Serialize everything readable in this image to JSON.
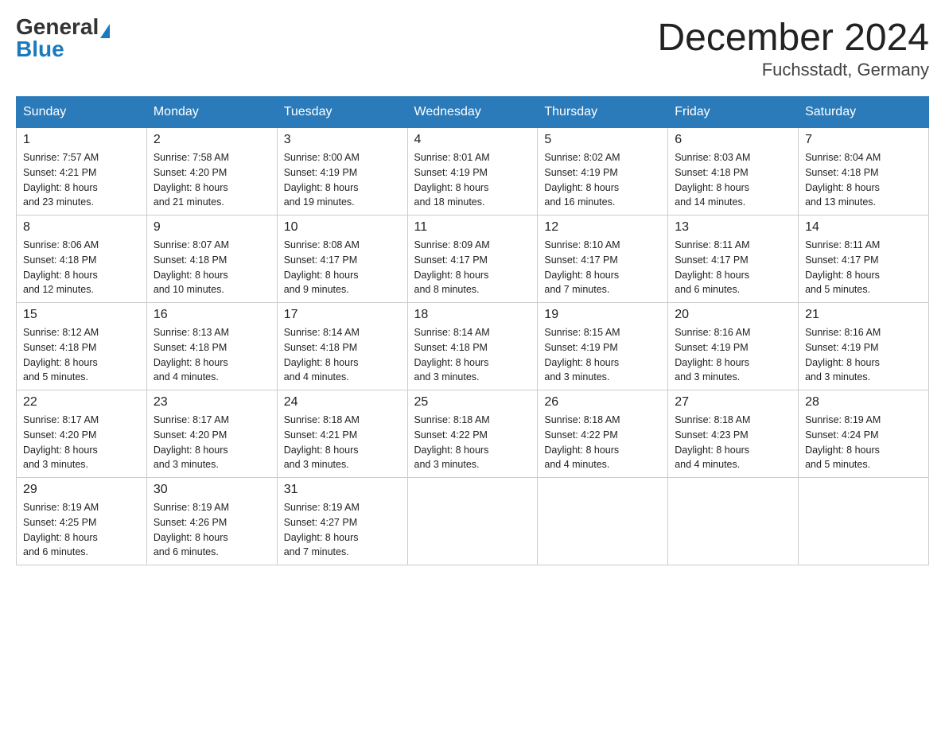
{
  "header": {
    "logo_general": "General",
    "logo_blue": "Blue",
    "month_title": "December 2024",
    "location": "Fuchsstadt, Germany"
  },
  "weekdays": [
    "Sunday",
    "Monday",
    "Tuesday",
    "Wednesday",
    "Thursday",
    "Friday",
    "Saturday"
  ],
  "weeks": [
    [
      {
        "day": "1",
        "sunrise": "7:57 AM",
        "sunset": "4:21 PM",
        "daylight": "8 hours and 23 minutes."
      },
      {
        "day": "2",
        "sunrise": "7:58 AM",
        "sunset": "4:20 PM",
        "daylight": "8 hours and 21 minutes."
      },
      {
        "day": "3",
        "sunrise": "8:00 AM",
        "sunset": "4:19 PM",
        "daylight": "8 hours and 19 minutes."
      },
      {
        "day": "4",
        "sunrise": "8:01 AM",
        "sunset": "4:19 PM",
        "daylight": "8 hours and 18 minutes."
      },
      {
        "day": "5",
        "sunrise": "8:02 AM",
        "sunset": "4:19 PM",
        "daylight": "8 hours and 16 minutes."
      },
      {
        "day": "6",
        "sunrise": "8:03 AM",
        "sunset": "4:18 PM",
        "daylight": "8 hours and 14 minutes."
      },
      {
        "day": "7",
        "sunrise": "8:04 AM",
        "sunset": "4:18 PM",
        "daylight": "8 hours and 13 minutes."
      }
    ],
    [
      {
        "day": "8",
        "sunrise": "8:06 AM",
        "sunset": "4:18 PM",
        "daylight": "8 hours and 12 minutes."
      },
      {
        "day": "9",
        "sunrise": "8:07 AM",
        "sunset": "4:18 PM",
        "daylight": "8 hours and 10 minutes."
      },
      {
        "day": "10",
        "sunrise": "8:08 AM",
        "sunset": "4:17 PM",
        "daylight": "8 hours and 9 minutes."
      },
      {
        "day": "11",
        "sunrise": "8:09 AM",
        "sunset": "4:17 PM",
        "daylight": "8 hours and 8 minutes."
      },
      {
        "day": "12",
        "sunrise": "8:10 AM",
        "sunset": "4:17 PM",
        "daylight": "8 hours and 7 minutes."
      },
      {
        "day": "13",
        "sunrise": "8:11 AM",
        "sunset": "4:17 PM",
        "daylight": "8 hours and 6 minutes."
      },
      {
        "day": "14",
        "sunrise": "8:11 AM",
        "sunset": "4:17 PM",
        "daylight": "8 hours and 5 minutes."
      }
    ],
    [
      {
        "day": "15",
        "sunrise": "8:12 AM",
        "sunset": "4:18 PM",
        "daylight": "8 hours and 5 minutes."
      },
      {
        "day": "16",
        "sunrise": "8:13 AM",
        "sunset": "4:18 PM",
        "daylight": "8 hours and 4 minutes."
      },
      {
        "day": "17",
        "sunrise": "8:14 AM",
        "sunset": "4:18 PM",
        "daylight": "8 hours and 4 minutes."
      },
      {
        "day": "18",
        "sunrise": "8:14 AM",
        "sunset": "4:18 PM",
        "daylight": "8 hours and 3 minutes."
      },
      {
        "day": "19",
        "sunrise": "8:15 AM",
        "sunset": "4:19 PM",
        "daylight": "8 hours and 3 minutes."
      },
      {
        "day": "20",
        "sunrise": "8:16 AM",
        "sunset": "4:19 PM",
        "daylight": "8 hours and 3 minutes."
      },
      {
        "day": "21",
        "sunrise": "8:16 AM",
        "sunset": "4:19 PM",
        "daylight": "8 hours and 3 minutes."
      }
    ],
    [
      {
        "day": "22",
        "sunrise": "8:17 AM",
        "sunset": "4:20 PM",
        "daylight": "8 hours and 3 minutes."
      },
      {
        "day": "23",
        "sunrise": "8:17 AM",
        "sunset": "4:20 PM",
        "daylight": "8 hours and 3 minutes."
      },
      {
        "day": "24",
        "sunrise": "8:18 AM",
        "sunset": "4:21 PM",
        "daylight": "8 hours and 3 minutes."
      },
      {
        "day": "25",
        "sunrise": "8:18 AM",
        "sunset": "4:22 PM",
        "daylight": "8 hours and 3 minutes."
      },
      {
        "day": "26",
        "sunrise": "8:18 AM",
        "sunset": "4:22 PM",
        "daylight": "8 hours and 4 minutes."
      },
      {
        "day": "27",
        "sunrise": "8:18 AM",
        "sunset": "4:23 PM",
        "daylight": "8 hours and 4 minutes."
      },
      {
        "day": "28",
        "sunrise": "8:19 AM",
        "sunset": "4:24 PM",
        "daylight": "8 hours and 5 minutes."
      }
    ],
    [
      {
        "day": "29",
        "sunrise": "8:19 AM",
        "sunset": "4:25 PM",
        "daylight": "8 hours and 6 minutes."
      },
      {
        "day": "30",
        "sunrise": "8:19 AM",
        "sunset": "4:26 PM",
        "daylight": "8 hours and 6 minutes."
      },
      {
        "day": "31",
        "sunrise": "8:19 AM",
        "sunset": "4:27 PM",
        "daylight": "8 hours and 7 minutes."
      },
      null,
      null,
      null,
      null
    ]
  ],
  "labels": {
    "sunrise": "Sunrise:",
    "sunset": "Sunset:",
    "daylight": "Daylight:"
  }
}
